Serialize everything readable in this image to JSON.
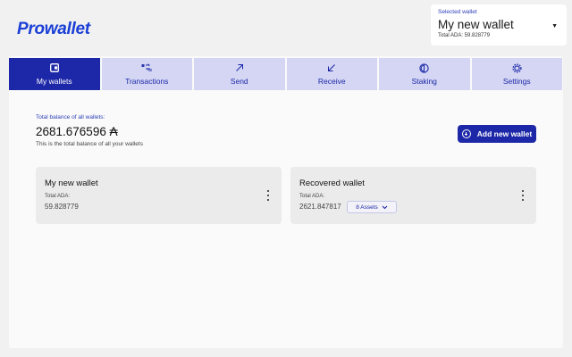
{
  "app": {
    "logo": "Prowallet"
  },
  "selected_wallet": {
    "label": "Selected wallet",
    "name": "My new wallet",
    "total": "Total ADA: 59.828779"
  },
  "tabs": [
    {
      "label": "My wallets",
      "icon": "wallet-icon",
      "active": true
    },
    {
      "label": "Transactions",
      "icon": "transactions-icon",
      "active": false
    },
    {
      "label": "Send",
      "icon": "arrow-up-right-icon",
      "active": false
    },
    {
      "label": "Receive",
      "icon": "arrow-down-left-icon",
      "active": false
    },
    {
      "label": "Staking",
      "icon": "staking-icon",
      "active": false
    },
    {
      "label": "Settings",
      "icon": "gear-icon",
      "active": false
    }
  ],
  "balance": {
    "label": "Total balance of all wallets:",
    "value": "2681.676596 ₳",
    "description": "This is the total balance of all your wallets"
  },
  "add_button": {
    "label": "Add new wallet"
  },
  "wallets": [
    {
      "name": "My new wallet",
      "total_label": "Total ADA:",
      "total": "59.828779"
    },
    {
      "name": "Recovered wallet",
      "total_label": "Total ADA:",
      "total": "2621.847817",
      "assets": "8 Assets"
    }
  ],
  "colors": {
    "accent": "#1d28a8",
    "tab_bg": "#d4d6f3",
    "logo": "#1a3fd6"
  }
}
